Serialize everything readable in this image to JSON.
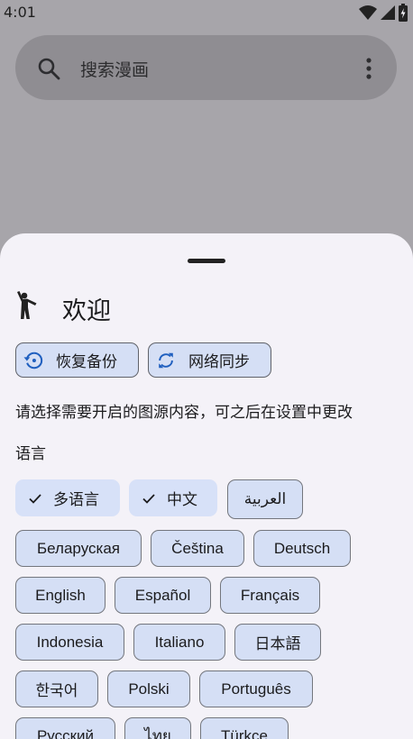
{
  "status_bar": {
    "time": "4:01",
    "icons": [
      "wifi-icon",
      "cellular-signal-icon",
      "battery-icon"
    ]
  },
  "search": {
    "placeholder": "搜索漫画",
    "icons": [
      "search-icon",
      "more-vert-icon"
    ]
  },
  "sheet": {
    "title": "欢迎",
    "title_icon": "person-wave-icon",
    "actions": [
      {
        "label": "恢复备份",
        "icon": "restore-icon"
      },
      {
        "label": "网络同步",
        "icon": "sync-icon"
      }
    ],
    "description": "请选择需要开启的图源内容，可之后在设置中更改",
    "language_label": "语言",
    "languages": [
      {
        "label": "多语言",
        "selected": true
      },
      {
        "label": "中文",
        "selected": true
      },
      {
        "label": "العربية",
        "selected": false
      },
      {
        "label": "Беларуская",
        "selected": false
      },
      {
        "label": "Čeština",
        "selected": false
      },
      {
        "label": "Deutsch",
        "selected": false
      },
      {
        "label": "English",
        "selected": false
      },
      {
        "label": "Español",
        "selected": false
      },
      {
        "label": "Français",
        "selected": false
      },
      {
        "label": "Indonesia",
        "selected": false
      },
      {
        "label": "Italiano",
        "selected": false
      },
      {
        "label": "日本語",
        "selected": false
      },
      {
        "label": "한국어",
        "selected": false
      },
      {
        "label": "Polski",
        "selected": false
      },
      {
        "label": "Português",
        "selected": false
      },
      {
        "label": "Русский",
        "selected": false
      },
      {
        "label": "ไทย",
        "selected": false
      },
      {
        "label": "Türkçe",
        "selected": false
      }
    ]
  },
  "colors": {
    "scrim": "#a7a5aa",
    "sheet_bg": "#f4f2f8",
    "chip_bg": "#d5dff5",
    "accent": "#1f5fbf"
  }
}
